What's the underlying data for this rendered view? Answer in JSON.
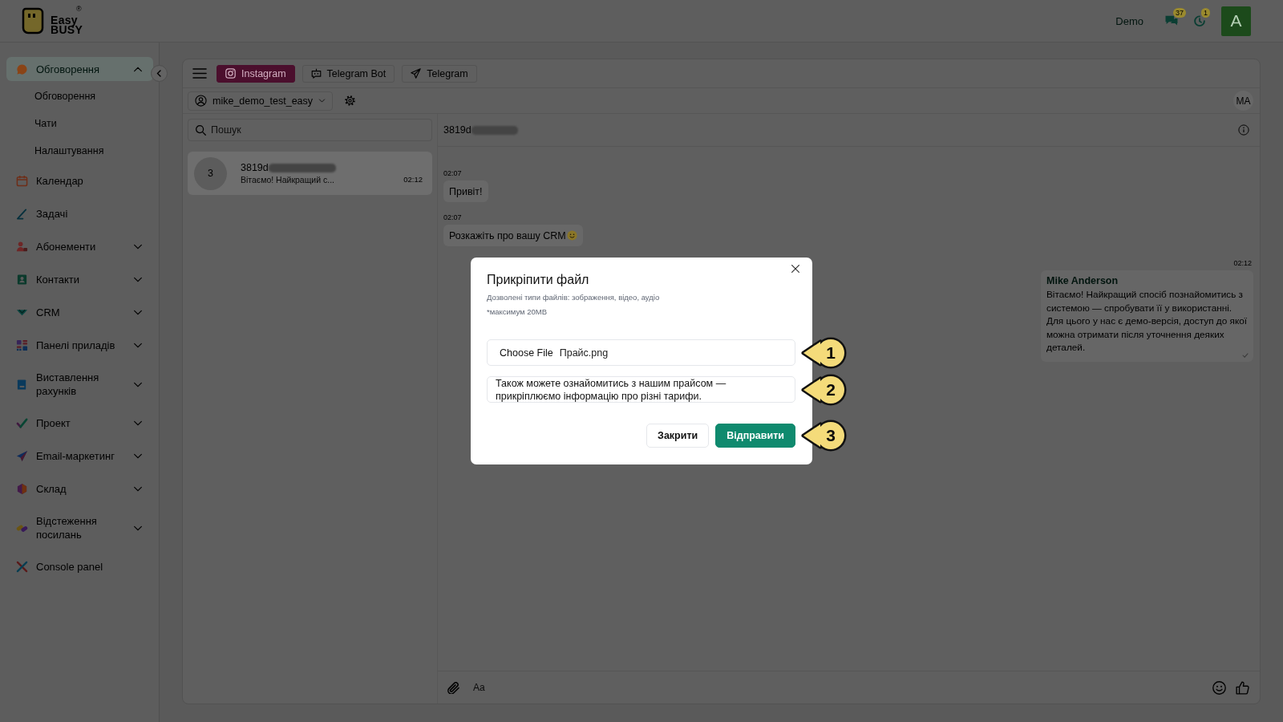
{
  "header": {
    "logo": {
      "line_1": "Easy",
      "line_2": "BUSY",
      "mark": "®"
    },
    "account": "Demo",
    "counters": [
      {
        "count": "37"
      },
      {
        "count": "1"
      }
    ],
    "avatar": "A"
  },
  "sidebar": {
    "items": [
      {
        "label": "Обговорення",
        "kind": "group",
        "expanded": true,
        "selected": true,
        "children": [
          {
            "label": "Обговорення"
          },
          {
            "label": "Чати"
          },
          {
            "label": "Налаштування"
          }
        ]
      },
      {
        "label": "Календар",
        "kind": "link",
        "selected": false
      },
      {
        "label": "Задачі",
        "kind": "link",
        "selected": false
      },
      {
        "label": "Абонементи",
        "kind": "group",
        "expanded": false,
        "selected": false
      },
      {
        "label": "Контакти",
        "kind": "group",
        "expanded": false,
        "selected": false
      },
      {
        "label": "CRM",
        "kind": "group",
        "expanded": false,
        "selected": false
      },
      {
        "label": "Панелі приладів",
        "kind": "group",
        "expanded": false,
        "selected": false
      },
      {
        "label": "Виставлення рахунків",
        "kind": "group",
        "expanded": false,
        "selected": false
      },
      {
        "label": "Проект",
        "kind": "group",
        "expanded": false,
        "selected": false
      },
      {
        "label": "Email-маркетинг",
        "kind": "group",
        "expanded": false,
        "selected": false
      },
      {
        "label": "Склад",
        "kind": "group",
        "expanded": false,
        "selected": false
      },
      {
        "label": "Відстеження посилань",
        "kind": "group",
        "expanded": false,
        "selected": false
      },
      {
        "label": "Console panel",
        "kind": "link",
        "selected": false
      }
    ]
  },
  "channel_tabs": [
    {
      "label": "Instagram",
      "selected": true
    },
    {
      "label": "Telegram Bot",
      "selected": false
    },
    {
      "label": "Telegram",
      "selected": false
    }
  ],
  "account_select": {
    "value": "mike_demo_test_easy"
  },
  "user_initials": "MA",
  "chat_list": {
    "search": {
      "placeholder": "Пошук"
    },
    "conversations": [
      {
        "avatar": "3",
        "name": "3819d",
        "name_blurred": true,
        "preview": "Вітаємо! Найкращий с...",
        "time": "02:12",
        "selected": true
      }
    ]
  },
  "chat": {
    "title": "3819d",
    "title_blurred": true,
    "messages": [
      {
        "kind": "incoming",
        "time": "02:07",
        "text": "Привіт!"
      },
      {
        "kind": "incoming",
        "time": "02:07",
        "text": "Розкажіть про вашу CRM",
        "emoji": true
      },
      {
        "kind": "outgoing",
        "time": "02:12",
        "sender": "Mike Anderson",
        "text": "Вітаємо! Найкращий спосіб познайомитись з системою — спробувати її у використанні. Для цього у нас є демо-версія, доступ до якої можна отримати після уточнення деяких деталей."
      }
    ],
    "composer": {
      "placeholder": "Aa"
    }
  },
  "dialog": {
    "title": "Прикріпити файл",
    "allowed_types": "Дозволені типи файлів: зображення, відео, аудіо",
    "size_limit": "*максимум 20MB",
    "file_button": "Choose File",
    "file_name": "Прайс.png",
    "message": "Також можете ознайомитись з нашим прайсом — прикріплюємо інформацію про різні тарифи.",
    "buttons": [
      {
        "label": "Закрити",
        "kind": "secondary"
      },
      {
        "label": "Відправити",
        "kind": "primary"
      }
    ],
    "callouts": [
      {
        "label": "1"
      },
      {
        "label": "2"
      },
      {
        "label": "3"
      }
    ]
  }
}
